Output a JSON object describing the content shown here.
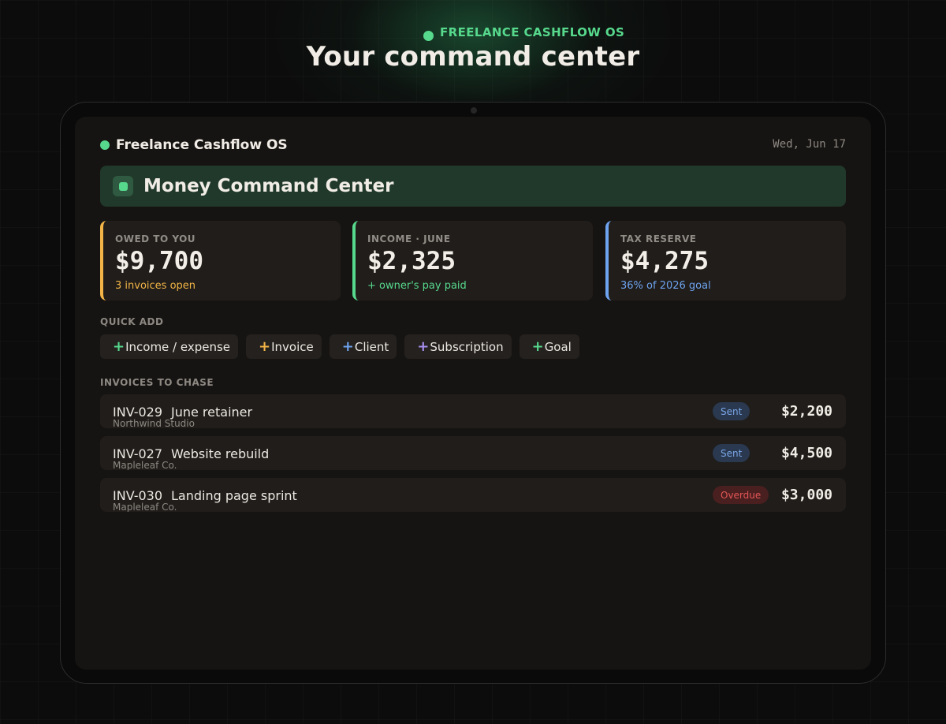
{
  "hero": {
    "eyebrow": "FREELANCE CASHFLOW OS",
    "title": "Your command center"
  },
  "app": {
    "brand": "Freelance Cashflow OS",
    "date": "Wed, Jun 17",
    "banner_title": "Money Command Center"
  },
  "stats": [
    {
      "label": "OWED TO YOU",
      "value": "$9,700",
      "sub": "3 invoices open",
      "color": "#f2b447"
    },
    {
      "label": "INCOME · JUNE",
      "value": "$2,325",
      "sub": "+ owner's pay paid",
      "color": "#57d98d"
    },
    {
      "label": "TAX RESERVE",
      "value": "$4,275",
      "sub": "36% of 2026 goal",
      "color": "#6ea3ef"
    }
  ],
  "quick_add": {
    "label": "QUICK ADD",
    "buttons": [
      {
        "plus": "+",
        "label": "Income / expense",
        "color": "#57d98d"
      },
      {
        "plus": "+",
        "label": "Invoice",
        "color": "#f2b447"
      },
      {
        "plus": "+",
        "label": "Client",
        "color": "#6ea3ef"
      },
      {
        "plus": "+",
        "label": "Subscription",
        "color": "#a98ef0"
      },
      {
        "plus": "+",
        "label": "Goal",
        "color": "#57d98d"
      }
    ]
  },
  "invoices": {
    "label": "INVOICES TO CHASE",
    "rows": [
      {
        "id": "INV-029",
        "title": "June retainer",
        "client": "Northwind Studio",
        "status": "Sent",
        "amount": "$2,200"
      },
      {
        "id": "INV-027",
        "title": "Website rebuild",
        "client": "Mapleleaf Co.",
        "status": "Sent",
        "amount": "$4,500"
      },
      {
        "id": "INV-030",
        "title": "Landing page sprint",
        "client": "Mapleleaf Co.",
        "status": "Overdue",
        "amount": "$3,000"
      }
    ]
  },
  "colors": {
    "accent_green": "#57d98d",
    "sent_badge": "#7aa6e6",
    "overdue_badge": "#e25656"
  }
}
